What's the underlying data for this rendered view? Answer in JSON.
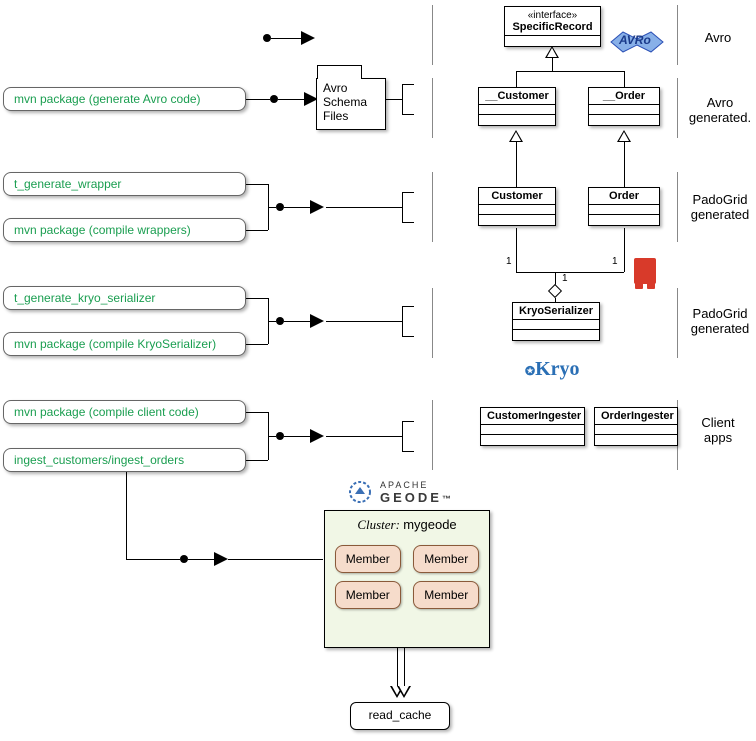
{
  "commands": {
    "gen_avro": "mvn package (generate Avro code)",
    "gen_wrapper": "t_generate_wrapper",
    "compile_wrappers": "mvn package (compile wrappers)",
    "gen_kryo": "t_generate_kryo_serializer",
    "compile_kryo": "mvn package (compile KryoSerializer)",
    "compile_client": "mvn package (compile client code)",
    "ingest": "ingest_customers/ingest_orders"
  },
  "pkg": {
    "schema_l1": "Avro",
    "schema_l2": "Schema",
    "schema_l3": "Files"
  },
  "classes": {
    "iface_stereo": "«interface»",
    "iface_name": "SpecificRecord",
    "cust_avro": "__Customer",
    "order_avro": "__Order",
    "cust": "Customer",
    "order": "Order",
    "kryo": "KryoSerializer",
    "cust_ing": "CustomerIngester",
    "order_ing": "OrderIngester"
  },
  "rowlabels": {
    "r1": "Avro",
    "r2a": "Avro",
    "r2b": "generated.",
    "r3a": "PadoGrid",
    "r3b": "generated",
    "r4a": "PadoGrid",
    "r4b": "generated",
    "r5a": "Client",
    "r5b": "apps"
  },
  "mult": {
    "one": "1"
  },
  "geode": {
    "apache": "APACHE",
    "name": "GEODE"
  },
  "cluster": {
    "label_prefix": "Cluster:",
    "name": "mygeode",
    "member": "Member"
  },
  "bottom": {
    "read": "read_cache"
  },
  "logos": {
    "kryo": "Kryo",
    "avro": "AVRo"
  }
}
